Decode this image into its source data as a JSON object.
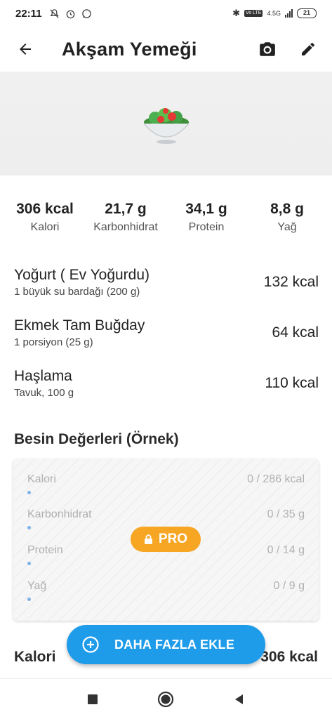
{
  "status_bar": {
    "time": "22:11",
    "network": "4.5G",
    "battery": "21"
  },
  "app_bar": {
    "title": "Akşam Yemeği"
  },
  "summary": [
    {
      "value": "306 kcal",
      "label": "Kalori"
    },
    {
      "value": "21,7 g",
      "label": "Karbonhidrat"
    },
    {
      "value": "34,1 g",
      "label": "Protein"
    },
    {
      "value": "8,8 g",
      "label": "Yağ"
    }
  ],
  "foods": [
    {
      "name": "Yoğurt ( Ev Yoğurdu)",
      "portion": "1 büyük su bardağı (200 g)",
      "kcal": "132 kcal"
    },
    {
      "name": "Ekmek Tam Buğday",
      "portion": "1 porsiyon (25 g)",
      "kcal": "64 kcal"
    },
    {
      "name": "Haşlama",
      "portion": "Tavuk, 100 g",
      "kcal": "110 kcal"
    }
  ],
  "nutrition": {
    "title": "Besin Değerleri (Örnek)",
    "rows": [
      {
        "label": "Kalori",
        "value": "0 / 286 kcal"
      },
      {
        "label": "Karbonhidrat",
        "value": "0 / 35 g"
      },
      {
        "label": "Protein",
        "value": "0 / 14 g"
      },
      {
        "label": "Yağ",
        "value": "0 / 9 g"
      }
    ],
    "pro_label": "PRO"
  },
  "total": {
    "label": "Kalori",
    "value": "306 kcal"
  },
  "fab": {
    "label": "DAHA FAZLA EKLE"
  },
  "colors": {
    "accent": "#1e9be9",
    "pro": "#f6a623"
  }
}
